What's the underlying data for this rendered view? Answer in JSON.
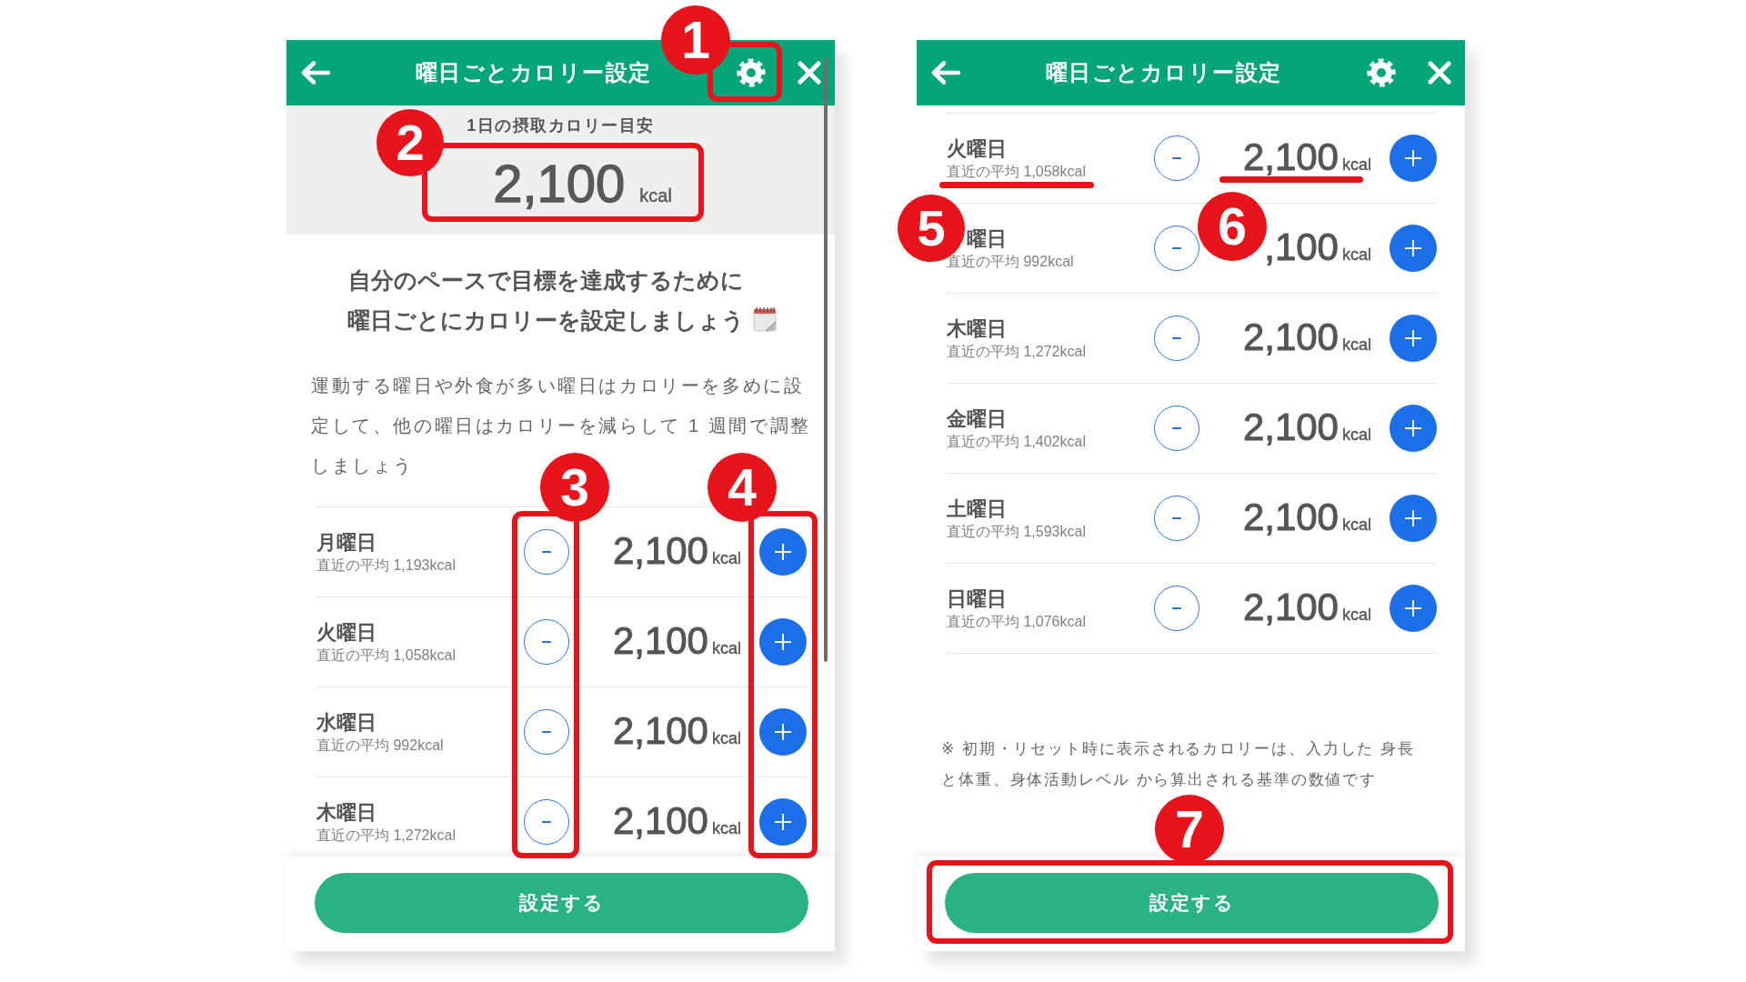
{
  "screens": [
    {
      "header": {
        "title": "曜日ごとカロリー設定"
      },
      "daily_target": {
        "label": "1日の摂取カロリー目安",
        "value": "2,100",
        "unit": "kcal"
      },
      "intro": {
        "heading": "自分のペースで目標を達成するために曜日ごとにカロリーを設定しましょう",
        "text": "運動する曜日や外食が多い曜日はカロリーを多めに設定して、他の曜日はカロリーを減らして 1 週間で調整しましょう"
      },
      "days": [
        {
          "name": "月曜日",
          "average": "直近の平均 1,193kcal",
          "value": "2,100",
          "unit": "kcal"
        },
        {
          "name": "火曜日",
          "average": "直近の平均 1,058kcal",
          "value": "2,100",
          "unit": "kcal"
        },
        {
          "name": "水曜日",
          "average": "直近の平均 992kcal",
          "value": "2,100",
          "unit": "kcal"
        },
        {
          "name": "木曜日",
          "average": "直近の平均 1,272kcal",
          "value": "2,100",
          "unit": "kcal"
        }
      ],
      "footer_button": "設定する",
      "annotations": [
        {
          "number": "1",
          "kind": "box"
        },
        {
          "number": "2",
          "kind": "box"
        },
        {
          "number": "3",
          "kind": "box"
        },
        {
          "number": "4",
          "kind": "box"
        }
      ]
    },
    {
      "header": {
        "title": "曜日ごとカロリー設定"
      },
      "days": [
        {
          "name": "火曜日",
          "average": "直近の平均 1,058kcal",
          "value": "2,100",
          "unit": "kcal"
        },
        {
          "name": "曜日",
          "average": "直近の平均 992kcal",
          "value": ",100",
          "unit": "kcal"
        },
        {
          "name": "木曜日",
          "average": "直近の平均 1,272kcal",
          "value": "2,100",
          "unit": "kcal"
        },
        {
          "name": "金曜日",
          "average": "直近の平均 1,402kcal",
          "value": "2,100",
          "unit": "kcal"
        },
        {
          "name": "土曜日",
          "average": "直近の平均 1,593kcal",
          "value": "2,100",
          "unit": "kcal"
        },
        {
          "name": "日曜日",
          "average": "直近の平均 1,076kcal",
          "value": "2,100",
          "unit": "kcal"
        }
      ],
      "note": "※ 初期・リセット時に表示されるカロリーは、入力した 身長と体重、身体活動レベル から算出される基準の数値です",
      "footer_button": "設定する",
      "annotations": [
        {
          "number": "5",
          "kind": "underline"
        },
        {
          "number": "6",
          "kind": "underline"
        },
        {
          "number": "7",
          "kind": "box"
        }
      ]
    }
  ]
}
